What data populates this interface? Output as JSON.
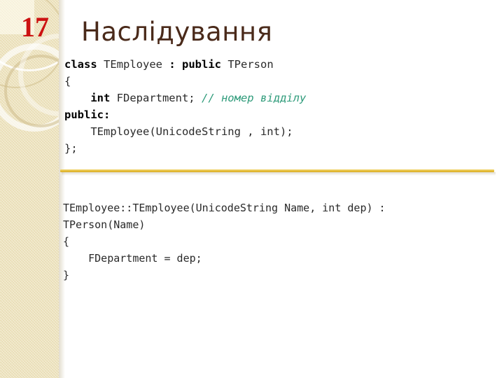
{
  "slide": {
    "number": "17",
    "title": "Наслідування",
    "accent_gold": "#e6bf3c",
    "sidebar_color": "#ede2bc",
    "title_color": "#4a2a1a",
    "number_color": "#cc1111",
    "comment_color": "#2e9b7a",
    "background_color": "#ffffff"
  },
  "code_top": {
    "lines": [
      {
        "tokens": [
          {
            "text": "class ",
            "kind": "keyword"
          },
          {
            "text": "TEmployee ",
            "kind": "identifier"
          },
          {
            "text": ": ",
            "kind": "keyword"
          },
          {
            "text": "public ",
            "kind": "keyword"
          },
          {
            "text": "TPerson",
            "kind": "identifier"
          }
        ]
      },
      {
        "tokens": [
          {
            "text": "{",
            "kind": "plain"
          }
        ]
      },
      {
        "tokens": [
          {
            "text": "    ",
            "kind": "plain"
          },
          {
            "text": "int ",
            "kind": "keyword"
          },
          {
            "text": "FDepartment; ",
            "kind": "identifier"
          },
          {
            "text": "// номер відділу",
            "kind": "comment"
          }
        ]
      },
      {
        "tokens": [
          {
            "text": "public:",
            "kind": "keyword"
          }
        ]
      },
      {
        "tokens": [
          {
            "text": "    TEmployee(UnicodeString , int);",
            "kind": "identifier"
          }
        ]
      },
      {
        "tokens": [
          {
            "text": "};",
            "kind": "plain"
          }
        ]
      }
    ]
  },
  "code_bottom": {
    "lines": [
      {
        "tokens": [
          {
            "text": "TEmployee::TEmployee(UnicodeString Name, int dep) :",
            "kind": "plain"
          }
        ]
      },
      {
        "tokens": [
          {
            "text": "TPerson(Name)",
            "kind": "plain"
          }
        ]
      },
      {
        "tokens": [
          {
            "text": "{",
            "kind": "plain"
          }
        ]
      },
      {
        "tokens": [
          {
            "text": "    FDepartment = dep;",
            "kind": "plain"
          }
        ]
      },
      {
        "tokens": [
          {
            "text": "}",
            "kind": "plain"
          }
        ]
      }
    ]
  }
}
